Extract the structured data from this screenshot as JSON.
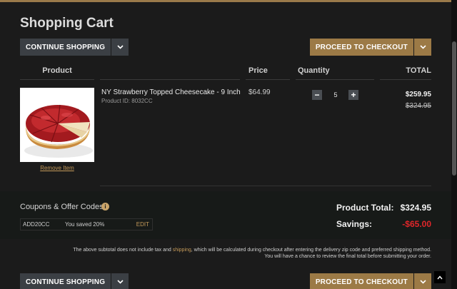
{
  "page": {
    "title": "Shopping Cart"
  },
  "buttons": {
    "continue_shopping": "CONTINUE SHOPPING",
    "proceed_checkout": "PROCEED TO CHECKOUT"
  },
  "table_headers": {
    "product": "Product",
    "price": "Price",
    "quantity": "Quantity",
    "total": "TOTAL"
  },
  "item": {
    "name": "NY Strawberry Topped Cheesecake - 9 Inch",
    "product_id": "Product ID: 8032CC",
    "price": "$64.99",
    "quantity": "5",
    "minus": "−",
    "plus": "+",
    "total": "$259.95",
    "original_total": "$324.95",
    "remove_label": "Remove Item"
  },
  "coupons": {
    "title": "Coupons & Offer Codes",
    "info_icon": "i",
    "code": "ADD20CC",
    "saved": "You saved 20%",
    "edit": "EDIT"
  },
  "summary": {
    "product_total_label": "Product Total:",
    "product_total_value": "$324.95",
    "savings_label": "Savings:",
    "savings_value": "-$65.00",
    "savings_color": "#e0262a"
  },
  "disclaimer": {
    "line1_before": "The above subtotal does not include tax and ",
    "line1_link": "shipping",
    "line1_after": ", which will be calculated during checkout after entering the delivery zip code and preferred shipping method.",
    "line2": "You will have a chance to review the final total before submitting your order."
  },
  "icons": {
    "caret": "chevron-down-icon",
    "back_to_top": "arrow-up-icon",
    "info": "info-icon"
  },
  "colors": {
    "accent_gold": "#9c7a46",
    "link_gold": "#c49a5a",
    "button_dark": "#3b3f44"
  }
}
